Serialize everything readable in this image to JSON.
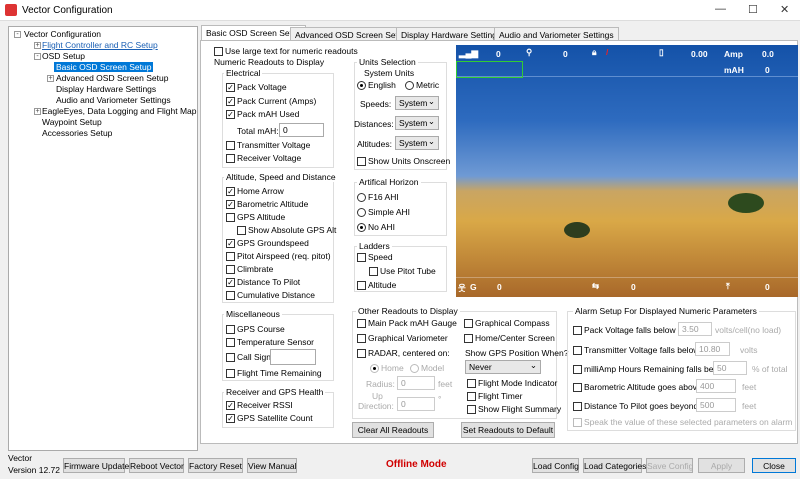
{
  "window": {
    "title": "Vector Configuration"
  },
  "tree": [
    "Vector Configuration",
    "Flight Controller and RC Setup",
    "OSD Setup",
    "Basic OSD Screen Setup",
    "Advanced OSD Screen Setup",
    "Display Hardware Settings",
    "Audio and Variometer Settings",
    "EagleEyes, Data Logging and Flight Map",
    "Waypoint Setup",
    "Accessories Setup"
  ],
  "tabs": [
    "Basic OSD Screen Setup",
    "Advanced OSD Screen Setup",
    "Display Hardware Settings",
    "Audio and Variometer Settings"
  ],
  "large_text": {
    "label": "Use large text for numeric readouts",
    "checked": false
  },
  "numeric_title": "Numeric Readouts to Display",
  "electrical": {
    "title": "Electrical",
    "items": [
      {
        "label": "Pack Voltage",
        "checked": true
      },
      {
        "label": "Pack Current (Amps)",
        "checked": true
      },
      {
        "label": "Pack mAH Used",
        "checked": true
      },
      {
        "label": "Transmitter Voltage",
        "checked": false
      },
      {
        "label": "Receiver Voltage",
        "checked": false
      }
    ],
    "total_label": "Total mAH:",
    "total_value": "0"
  },
  "altitude": {
    "title": "Altitude, Speed and Distance",
    "items": [
      {
        "label": "Home Arrow",
        "checked": true
      },
      {
        "label": "Barometric Altitude",
        "checked": true
      },
      {
        "label": "GPS Altitude",
        "checked": false
      },
      {
        "label": "Show Absolute GPS Alt",
        "checked": false
      },
      {
        "label": "GPS Groundspeed",
        "checked": true
      },
      {
        "label": "Pitot Airspeed (req. pitot)",
        "checked": false
      },
      {
        "label": "Climbrate",
        "checked": false
      },
      {
        "label": "Distance To Pilot",
        "checked": true
      },
      {
        "label": "Cumulative Distance",
        "checked": false
      }
    ]
  },
  "misc": {
    "title": "Miscellaneous",
    "items": [
      {
        "label": "GPS Course",
        "checked": false
      },
      {
        "label": "Temperature Sensor",
        "checked": false
      },
      {
        "label": "Call Sign",
        "checked": false
      },
      {
        "label": "Flight Time Remaining",
        "checked": false
      }
    ],
    "call_sign": ""
  },
  "receiver": {
    "title": "Receiver and GPS Health",
    "items": [
      {
        "label": "Receiver RSSI",
        "checked": true
      },
      {
        "label": "GPS Satellite Count",
        "checked": true
      }
    ]
  },
  "units": {
    "title": "Units Selection",
    "system_label": "System Units",
    "english": "English",
    "metric": "Metric",
    "selected": "English",
    "speeds_label": "Speeds:",
    "distances_label": "Distances:",
    "altitudes_label": "Altitudes:",
    "speeds": "System",
    "distances": "System",
    "altitudes": "System",
    "show_units": {
      "label": "Show Units Onscreen",
      "checked": false
    }
  },
  "ahi": {
    "title": "Artifical Horizon",
    "options": [
      "F16 AHI",
      "Simple AHI",
      "No AHI"
    ],
    "selected": "No AHI"
  },
  "ladders": {
    "title": "Ladders",
    "items": [
      {
        "label": "Speed",
        "checked": false
      },
      {
        "label": "Use Pitot Tube",
        "checked": false
      },
      {
        "label": "Altitude",
        "checked": false
      }
    ]
  },
  "other": {
    "title": "Other Readouts to Display",
    "items": [
      {
        "label": "Main Pack mAH Gauge",
        "checked": false
      },
      {
        "label": "Graphical Variometer",
        "checked": false
      },
      {
        "label": "RADAR, centered on:",
        "checked": false
      },
      {
        "label": "Graphical Compass",
        "checked": false
      },
      {
        "label": "Home/Center Screen",
        "checked": false
      },
      {
        "label": "Flight Mode Indicator",
        "checked": false
      },
      {
        "label": "Flight Timer",
        "checked": false
      },
      {
        "label": "Show Flight Summary",
        "checked": false
      }
    ],
    "home": "Home",
    "model": "Model",
    "radius_label": "Radius:",
    "radius": "0",
    "radius_unit": "feet",
    "up_label": "Up",
    "direction_label": "Direction:",
    "direction": "0",
    "direction_unit": "°",
    "gps_label": "Show GPS Position When?",
    "gps_value": "Never"
  },
  "alarm": {
    "title": "Alarm Setup For Displayed Numeric Parameters",
    "items": [
      {
        "label": "Pack Voltage falls below",
        "value": "3.50",
        "unit": "volts/cell(no load)",
        "checked": false
      },
      {
        "label": "Transmitter Voltage falls below",
        "value": "10.80",
        "unit": "volts",
        "checked": false
      },
      {
        "label": "milliAmp Hours Remaining falls below",
        "value": "50",
        "unit": "% of total",
        "checked": false
      },
      {
        "label": "Barometric Altitude goes above",
        "value": "400",
        "unit": "feet",
        "checked": false
      },
      {
        "label": "Distance To Pilot goes beyond",
        "value": "500",
        "unit": "feet",
        "checked": false
      }
    ],
    "speak": "Speak the value of these selected parameters on alarm"
  },
  "buttons": {
    "clear": "Clear All Readouts",
    "default": "Set Readouts to Default"
  },
  "osd": {
    "rssi": "0",
    "sats": "0",
    "current": "0.00",
    "amp_label": "Amp",
    "amp": "0.0",
    "mah_label": "mAH",
    "mah": "0",
    "g_label": "G",
    "speed": "0",
    "dist": "0",
    "alt": "0"
  },
  "footer": {
    "vector": "Vector",
    "version": "Version 12.72",
    "firmware": "Firmware Update",
    "reboot": "Reboot Vector",
    "factory": "Factory Reset",
    "manual": "View Manual",
    "status": "Offline Mode",
    "status_color": "#d00000",
    "load": "Load Config",
    "load_cat": "Load Categories",
    "save": "Save Config",
    "apply": "Apply",
    "close": "Close"
  }
}
